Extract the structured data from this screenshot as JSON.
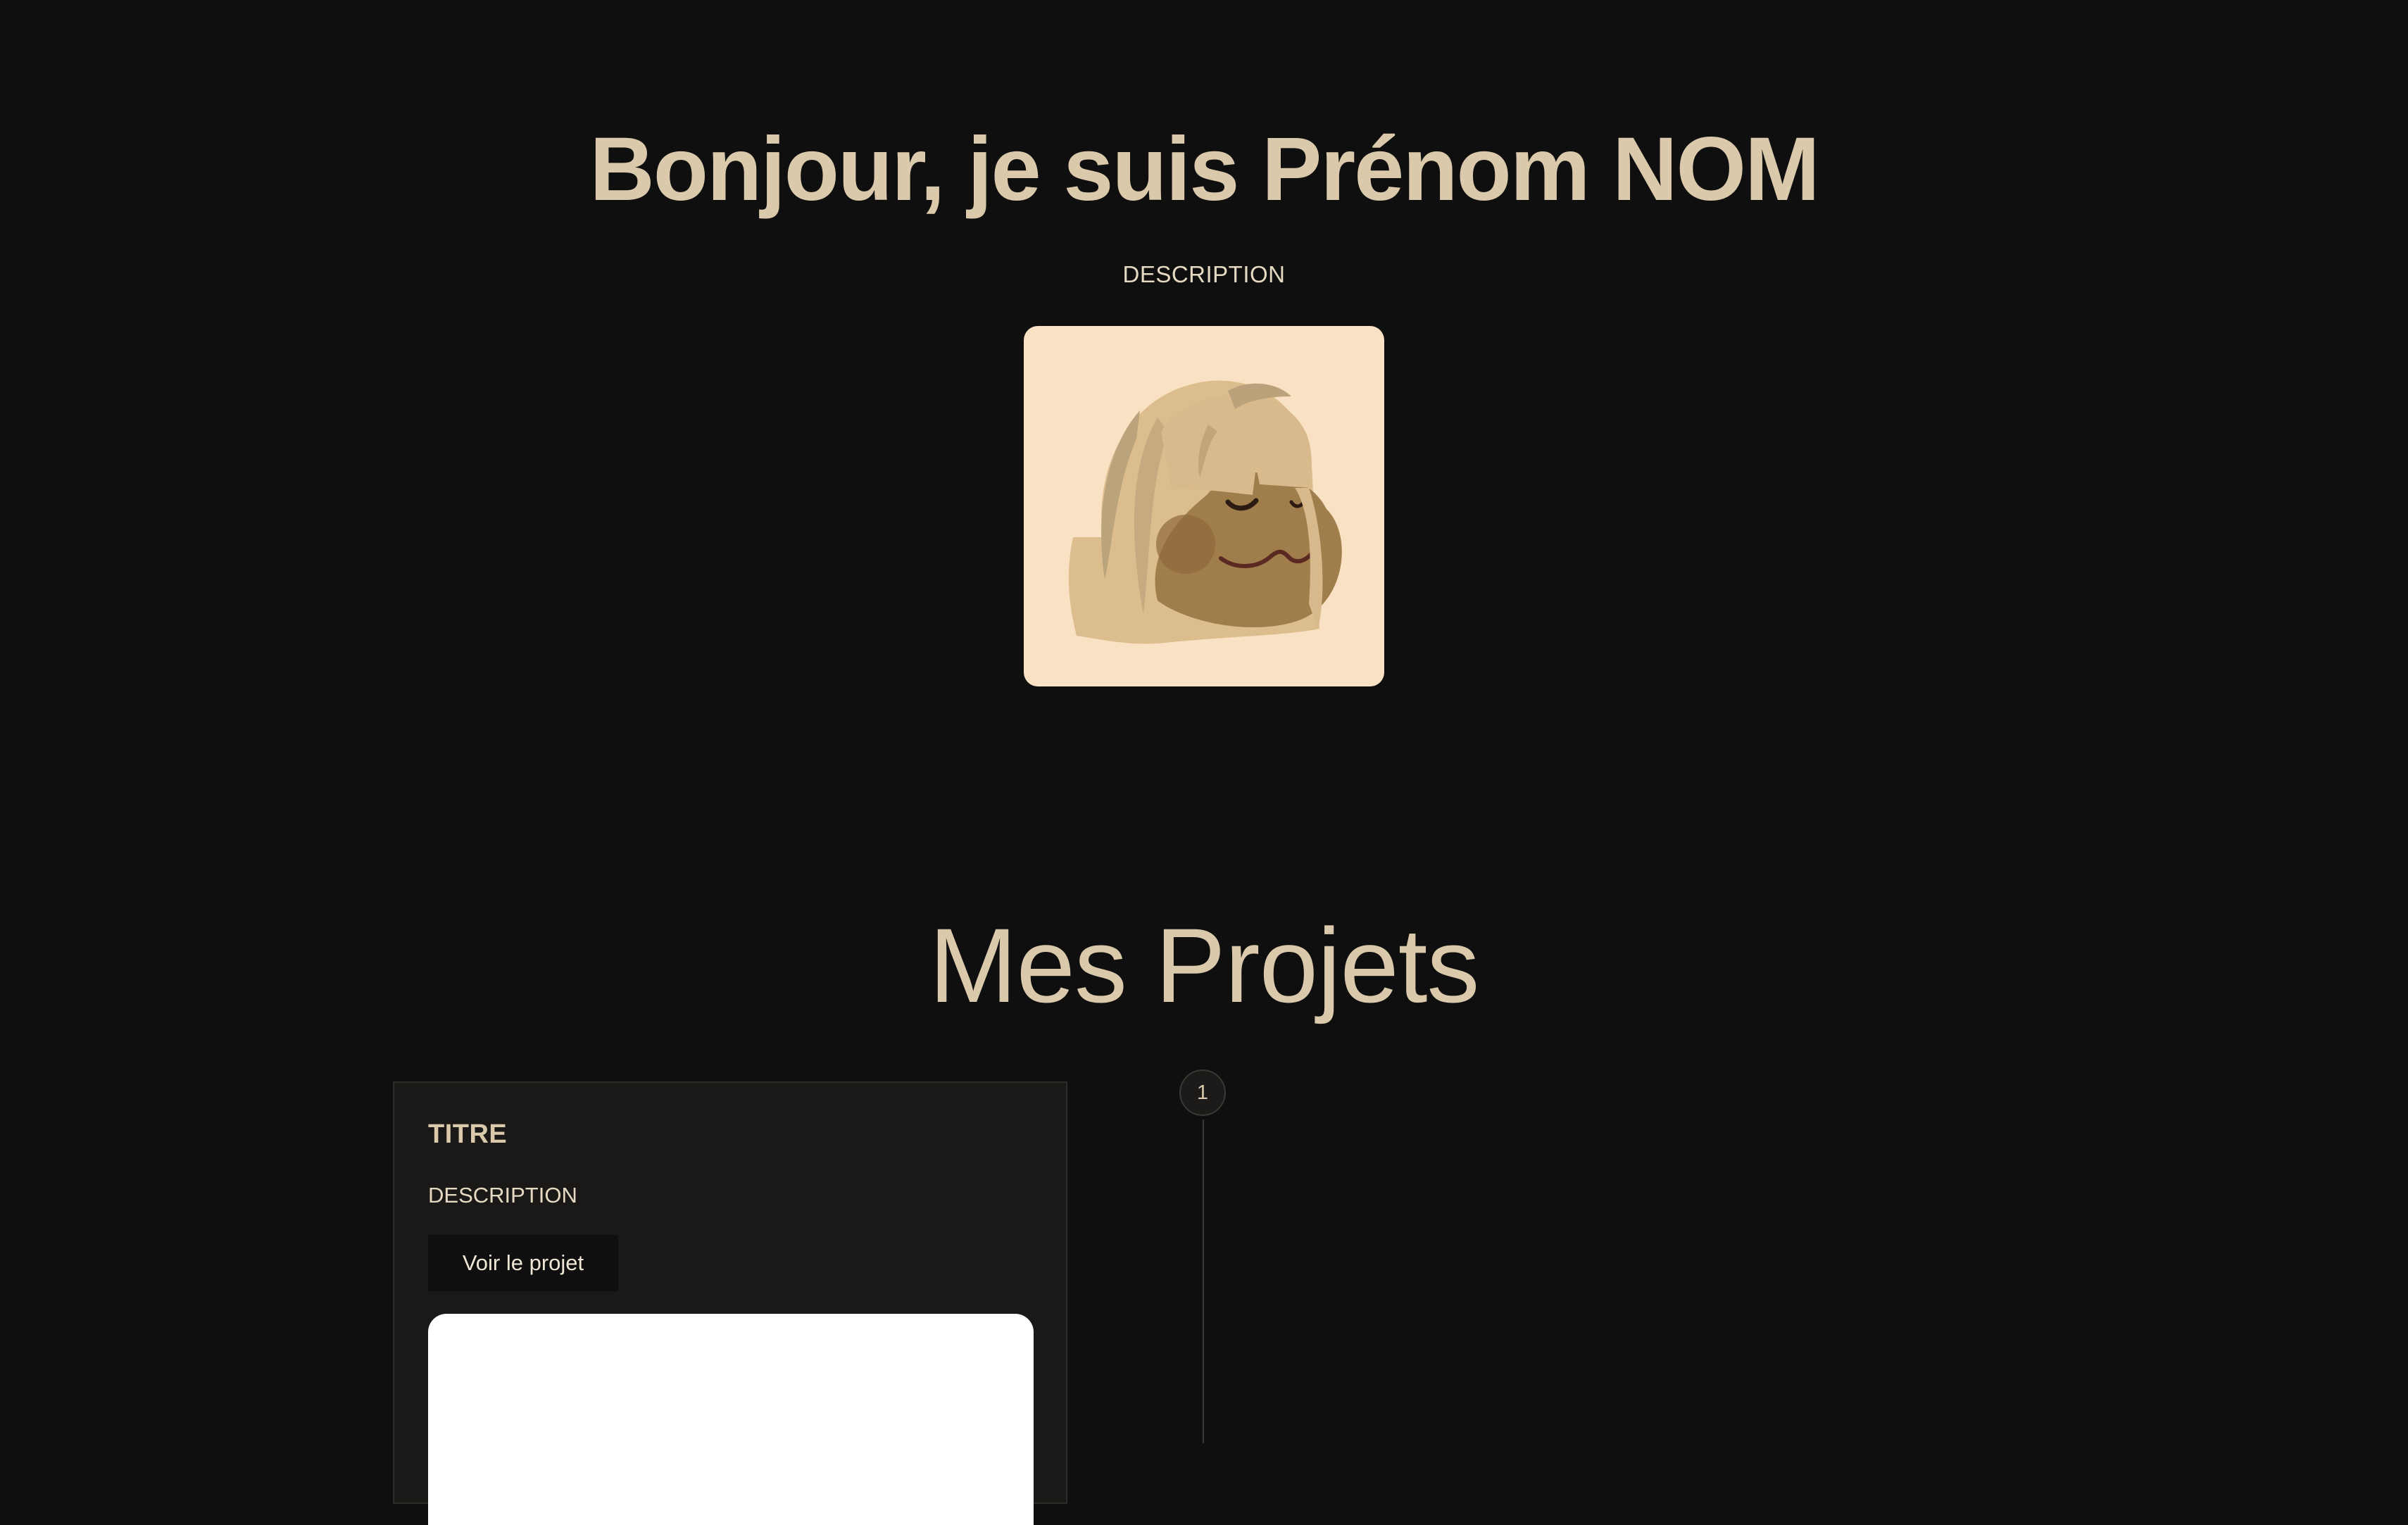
{
  "hero": {
    "title": "Bonjour, je suis Prénom NOM",
    "description": "DESCRIPTION"
  },
  "avatar": {
    "icon": "memoji-avatar-icon",
    "background_color": "#f9e1c3"
  },
  "projects": {
    "heading": "Mes Projets",
    "items": [
      {
        "step": "1",
        "title": "TITRE",
        "description": "DESCRIPTION",
        "button_label": "Voir le projet"
      }
    ]
  },
  "colors": {
    "background": "#0f0f0f",
    "accent": "#dbc9ab",
    "card": "#1a1917"
  }
}
